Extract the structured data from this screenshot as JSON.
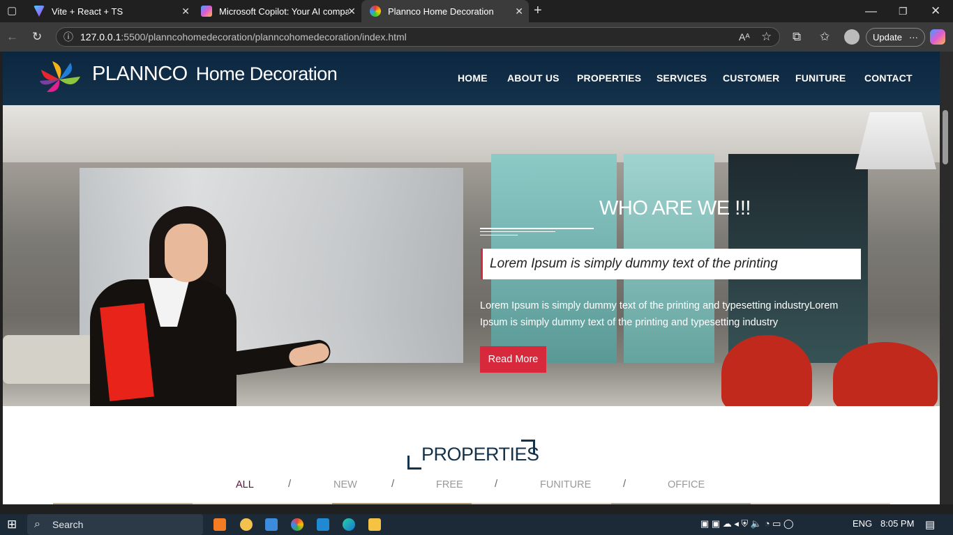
{
  "browser": {
    "tabs": [
      {
        "title": "Vite + React + TS",
        "active": false
      },
      {
        "title": "Microsoft Copilot: Your AI compa",
        "active": false
      },
      {
        "title": "Plannco Home Decoration",
        "active": true
      }
    ],
    "url_host": "127.0.0.1",
    "url_rest": ":5500/planncohomedecoration/planncohomedecoration/index.html",
    "update_label": "Update"
  },
  "site": {
    "brand_main": "PLANNCO",
    "brand_sub": "Home Decoration",
    "nav": [
      "HOME",
      "ABOUT US",
      "PROPERTIES",
      "SERVICES",
      "CUSTOMER",
      "FUNITURE",
      "CONTACT"
    ],
    "hero": {
      "heading": "WHO ARE WE !!!",
      "quote": "Lorem Ipsum is simply dummy text of the printing",
      "description": "Lorem Ipsum is simply dummy text of the printing and typesetting industryLorem Ipsum is simply dummy text of the printing and typesetting industry",
      "button": "Read More"
    },
    "properties": {
      "title": "PROPERTIES",
      "filters": [
        "ALL",
        "NEW",
        "FREE",
        "FUNITURE",
        "OFFICE"
      ],
      "active_filter": "ALL"
    }
  },
  "taskbar": {
    "search_label": "Search",
    "language": "ENG",
    "time": "8:05 PM"
  },
  "colors": {
    "header_bg": "#15324b",
    "accent_red": "#d7283c",
    "accent_purple": "#5a1438"
  }
}
